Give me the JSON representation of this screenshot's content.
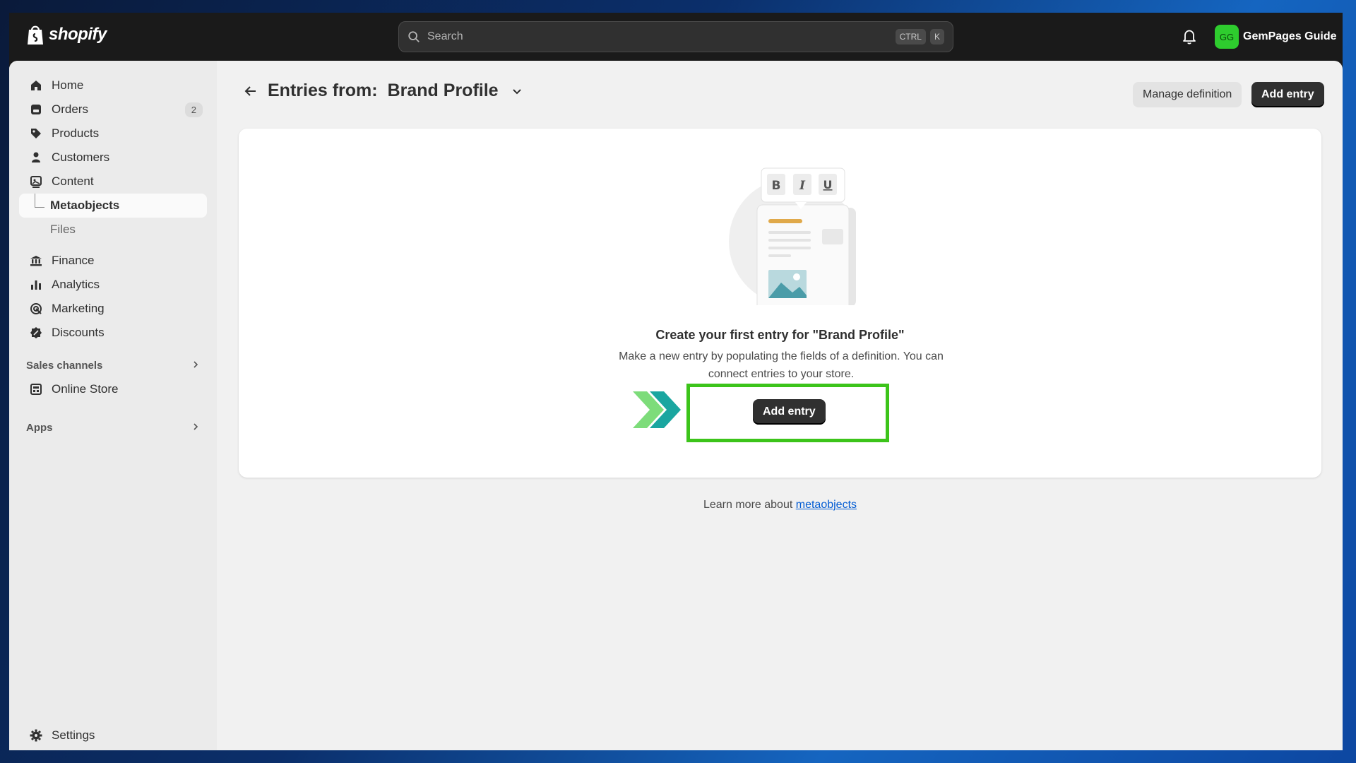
{
  "brand": {
    "name": "shopify"
  },
  "search": {
    "placeholder": "Search",
    "kbd1": "CTRL",
    "kbd2": "K"
  },
  "user": {
    "initials": "GG",
    "name": "GemPages Guide"
  },
  "sidebar": {
    "items": [
      {
        "label": "Home",
        "icon": "home-icon"
      },
      {
        "label": "Orders",
        "icon": "orders-icon",
        "badge": "2"
      },
      {
        "label": "Products",
        "icon": "tag-icon"
      },
      {
        "label": "Customers",
        "icon": "person-icon"
      },
      {
        "label": "Content",
        "icon": "content-icon"
      },
      {
        "label": "Metaobjects",
        "active": true
      },
      {
        "label": "Files"
      },
      {
        "label": "Finance",
        "icon": "bank-icon"
      },
      {
        "label": "Analytics",
        "icon": "bar-chart-icon"
      },
      {
        "label": "Marketing",
        "icon": "target-icon"
      },
      {
        "label": "Discounts",
        "icon": "discount-icon"
      }
    ],
    "sales_channels": {
      "heading": "Sales channels",
      "items": [
        {
          "label": "Online Store",
          "icon": "store-icon"
        }
      ]
    },
    "apps": {
      "heading": "Apps"
    },
    "settings": {
      "label": "Settings",
      "icon": "gear-icon"
    }
  },
  "header": {
    "prefix": "Entries from:",
    "title": "Brand Profile"
  },
  "actions": {
    "manage": "Manage definition",
    "add": "Add entry"
  },
  "empty_state": {
    "title": "Create your first entry for \"Brand Profile\"",
    "description": "Make a new entry by populating the fields of a definition. You can connect entries to your store.",
    "button": "Add entry",
    "toolbar_letters": [
      "B",
      "I",
      "U"
    ]
  },
  "footer": {
    "text": "Learn more about",
    "link": "metaobjects"
  },
  "colors": {
    "highlight": "#3cc41a",
    "accent_green": "#2ecc2e",
    "link": "#005bd3"
  }
}
